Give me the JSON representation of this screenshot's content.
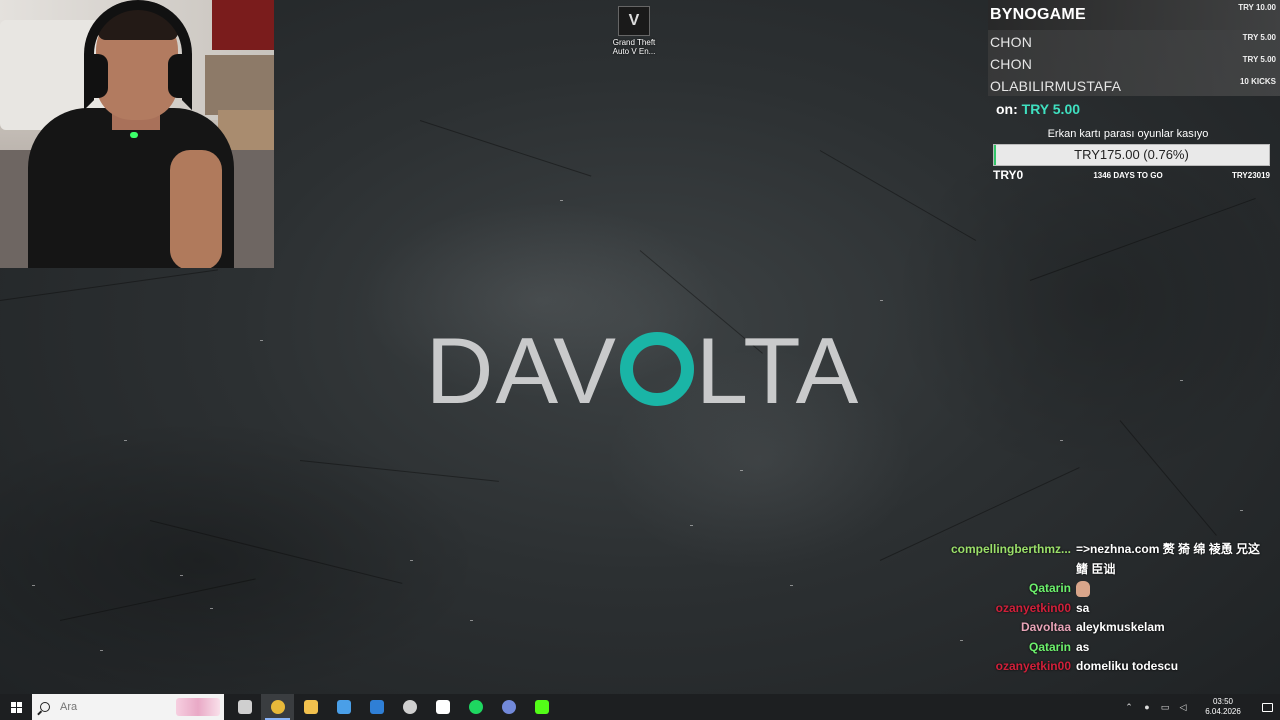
{
  "desktop": {
    "icon_label": "Grand Theft Auto V En...",
    "logo_left": "DAV",
    "logo_right": "LTA"
  },
  "donations": {
    "top": {
      "name": "BYNOGAME",
      "amount": "TRY 10.00"
    },
    "rows": [
      {
        "name": "CHON",
        "amount": "TRY 5.00"
      },
      {
        "name": "CHON",
        "amount": "TRY 5.00"
      },
      {
        "name": "OLABILIRMUSTAFA",
        "amount": "10 KICKS"
      }
    ],
    "latest_prefix": "on:",
    "latest_amount": "TRY 5.00",
    "goal_title": "Erkan kartı parası oyunlar kasıyo",
    "goal_text": "TRY175.00 (0.76%)",
    "goal_percent": 0.76,
    "goal_min": "TRY0",
    "goal_days": "1346 DAYS TO GO",
    "goal_max": "TRY23019"
  },
  "chat": [
    {
      "user": "compellingberthmz...",
      "text": "=>nezhna.com 赘 猗 绵 祾恿 兄这 鳍 臣诎",
      "color": "#9be06a"
    },
    {
      "user": "Qatarin",
      "text": "",
      "emote": true,
      "color": "#6cf06c"
    },
    {
      "user": "ozanyetkin00",
      "text": "sa",
      "color": "#d0203a"
    },
    {
      "user": "Davoltaa",
      "text": "aleykmuskelam",
      "color": "#e8a4b8"
    },
    {
      "user": "Qatarin",
      "text": "as",
      "color": "#6cf06c"
    },
    {
      "user": "ozanyetkin00",
      "text": "domeliku todescu",
      "color": "#d0203a"
    }
  ],
  "taskbar": {
    "search_placeholder": "Ara",
    "time": "03:50",
    "date": "6.04.2026",
    "apps": [
      {
        "name": "task-view-icon",
        "color": "#cfcfcf"
      },
      {
        "name": "chrome-icon",
        "color": "#e8b93a",
        "active": true
      },
      {
        "name": "file-explorer-icon",
        "color": "#f2c14e"
      },
      {
        "name": "microsoft-store-icon",
        "color": "#4a9fe8"
      },
      {
        "name": "mail-icon",
        "color": "#2f7fd6"
      },
      {
        "name": "obs-icon",
        "color": "#cfcfcf"
      },
      {
        "name": "capcut-icon",
        "color": "#ffffff"
      },
      {
        "name": "spotify-icon",
        "color": "#1ed760"
      },
      {
        "name": "discord-icon",
        "color": "#7289da"
      },
      {
        "name": "kick-icon",
        "color": "#53fc18"
      }
    ]
  }
}
